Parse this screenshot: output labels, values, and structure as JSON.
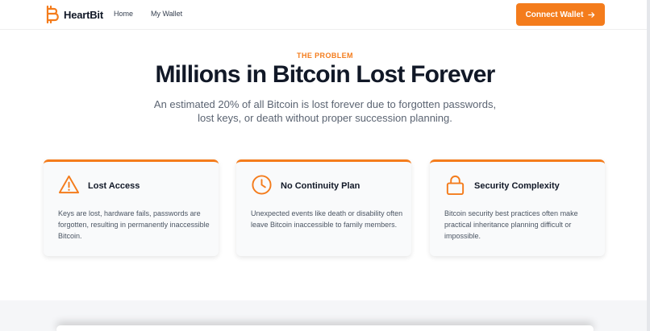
{
  "nav": {
    "brand": "HeartBit",
    "links": [
      "Home",
      "My Wallet"
    ],
    "cta_label": "Connect Wallet"
  },
  "hero": {
    "eyebrow": "THE PROBLEM",
    "title": "Millions in Bitcoin Lost Forever",
    "description": "An estimated 20% of all Bitcoin is lost forever due to forgotten passwords, lost keys, or death without proper succession planning."
  },
  "cards": [
    {
      "icon": "warning-triangle-icon",
      "title": "Lost Access",
      "body": "Keys are lost, hardware fails, passwords are forgotten, resulting in permanently inaccessible Bitcoin."
    },
    {
      "icon": "clock-icon",
      "title": "No Continuity Plan",
      "body": "Unexpected events like death or disability often leave Bitcoin inaccessible to family members."
    },
    {
      "icon": "lock-icon",
      "title": "Security Complexity",
      "body": "Bitcoin security best practices often make practical inheritance planning difficult or impossible."
    }
  ],
  "colors": {
    "accent": "#f47c1c",
    "heading": "#111827",
    "body_text": "#4b5563",
    "card_background": "#f9fafb",
    "section_background": "#f5f6f8"
  }
}
